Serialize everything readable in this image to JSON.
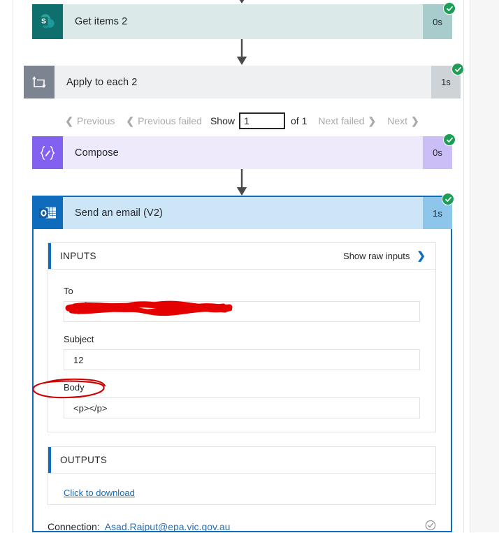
{
  "flow": {
    "steps": [
      {
        "id": "get-items-2",
        "title": "Get items 2",
        "duration": "0s",
        "icon": "sharepoint-icon",
        "status": "succeeded"
      },
      {
        "id": "apply-to-each-2",
        "title": "Apply to each 2",
        "duration": "1s",
        "icon": "loop-icon",
        "status": "succeeded"
      },
      {
        "id": "compose",
        "title": "Compose",
        "duration": "0s",
        "icon": "compose-braces-icon",
        "status": "succeeded"
      },
      {
        "id": "send-an-email-v2",
        "title": "Send an email (V2)",
        "duration": "1s",
        "icon": "outlook-icon",
        "status": "succeeded"
      }
    ]
  },
  "pagination": {
    "previous_label": "Previous",
    "previous_failed_label": "Previous failed",
    "show_label": "Show",
    "page_value": "1",
    "page_placeholder": "",
    "of_label": "of 1",
    "next_failed_label": "Next failed",
    "next_label": "Next"
  },
  "inputs": {
    "section_title": "INPUTS",
    "show_raw_label": "Show raw inputs",
    "fields": [
      {
        "label": "To",
        "value": "",
        "redacted": true
      },
      {
        "label": "Subject",
        "value": "12",
        "redacted": false
      },
      {
        "label": "Body",
        "value": "<p></p>",
        "redacted": false,
        "annotated": true
      }
    ]
  },
  "outputs": {
    "section_title": "OUTPUTS",
    "download_label": "Click to download"
  },
  "connection": {
    "label": "Connection:",
    "value": "Asad.Rajput@epa.vic.gov.au",
    "status": "verified"
  },
  "colors": {
    "accent_blue": "#0f6cbd",
    "success_green": "#1c9e57",
    "sharepoint_teal": "#0f6f6c",
    "compose_purple": "#8361f0",
    "loop_gray": "#7b8490",
    "annotation_red": "#e00000"
  }
}
